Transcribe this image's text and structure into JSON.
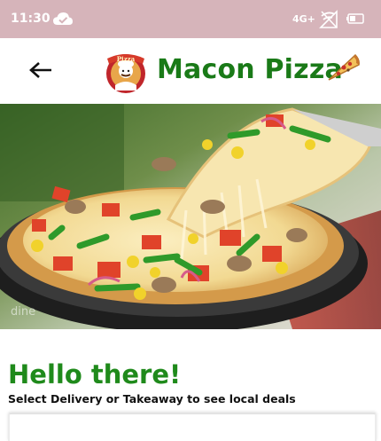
{
  "status_bar": {
    "time": "11:30",
    "network": "4G+",
    "icons": [
      "cloud-icon",
      "signal-icon",
      "battery-icon"
    ]
  },
  "app_bar": {
    "title": "Macon Pizza",
    "back_icon": "arrow-left-icon",
    "logo_text": "Pizza",
    "title_color": "#1a7a18"
  },
  "hero": {
    "watermark": "dine"
  },
  "main": {
    "greeting": "Hello there!",
    "subtitle": "Select Delivery or Takeaway to see local deals",
    "greeting_color": "#1f8a1b"
  },
  "colors": {
    "status_bar": "#d6b4ba",
    "brand_green": "#1a7a18"
  }
}
